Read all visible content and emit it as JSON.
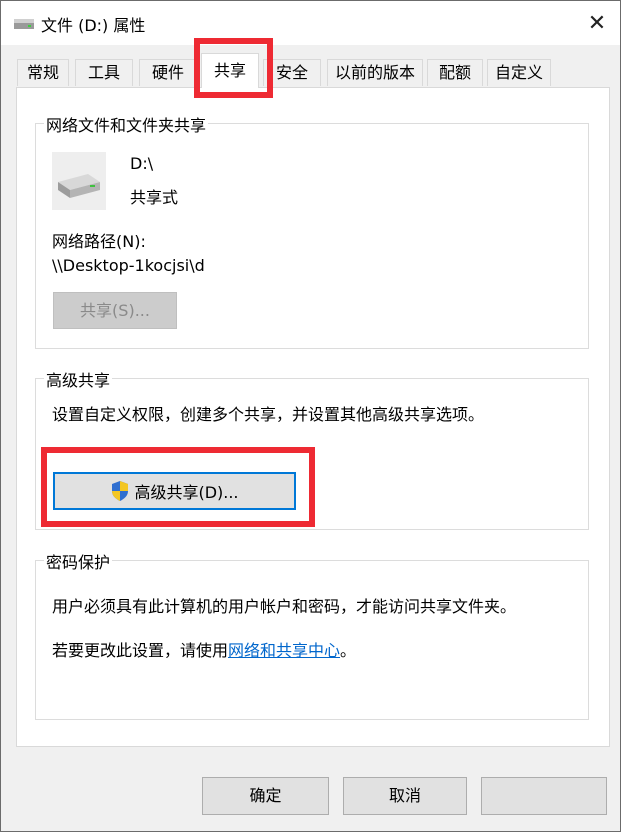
{
  "window": {
    "title": "文件 (D:) 属性",
    "close_glyph": "✕"
  },
  "tabs": [
    {
      "label": "常规"
    },
    {
      "label": "工具"
    },
    {
      "label": "硬件"
    },
    {
      "label": "共享"
    },
    {
      "label": "安全"
    },
    {
      "label": "以前的版本"
    },
    {
      "label": "配额"
    },
    {
      "label": "自定义"
    }
  ],
  "network_share": {
    "title": "网络文件和文件夹共享",
    "drive_name": "D:\\",
    "drive_status": "共享式",
    "path_label": "网络路径(N):",
    "path_value": "\\\\Desktop-1kocjsi\\d",
    "share_button": "共享(S)..."
  },
  "advanced_share": {
    "title": "高级共享",
    "description": "设置自定义权限，创建多个共享，并设置其他高级共享选项。",
    "button": "高级共享(D)..."
  },
  "password_protection": {
    "title": "密码保护",
    "text": "用户必须具有此计算机的用户帐户和密码，才能访问共享文件夹。",
    "change_prefix": "若要更改此设置，请使用",
    "link": "网络和共享中心",
    "change_suffix": "。"
  },
  "footer": {
    "ok": "确定",
    "cancel": "取消"
  }
}
